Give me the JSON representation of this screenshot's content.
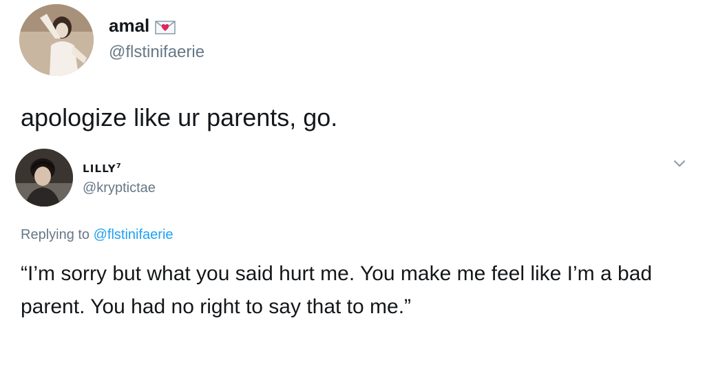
{
  "tweet": {
    "author": {
      "display_name": "amal",
      "handle": "@flstinifaerie",
      "name_emoji": "love-letter-icon"
    },
    "text": "apologize like ur parents, go."
  },
  "reply": {
    "author": {
      "display_name": "LILLY",
      "display_name_sup": "7",
      "handle": "@kryptictae"
    },
    "replying_prefix": "Replying to",
    "replying_to": "@flstinifaerie",
    "text": "“I’m sorry but what you said hurt me. You make me feel like I’m a bad parent. You had no right to say that to me.”",
    "menu_icon": "chevron-down-icon"
  },
  "colors": {
    "text_primary": "#14171a",
    "text_secondary": "#657786",
    "link": "#1da1f2"
  }
}
